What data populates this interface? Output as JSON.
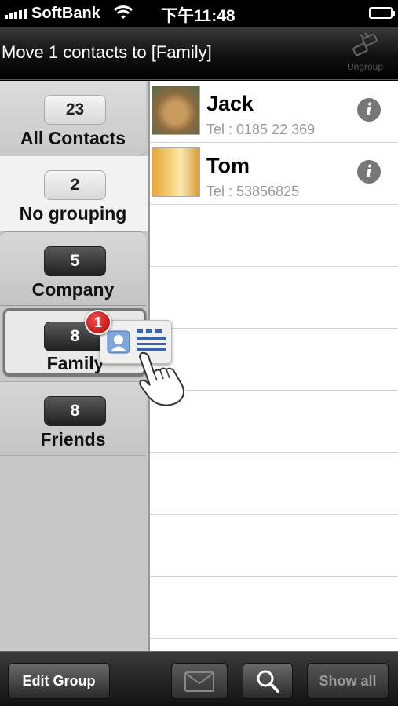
{
  "status_bar": {
    "carrier": "SoftBank",
    "time": "下午11:48"
  },
  "nav": {
    "title": "Move 1 contacts to [Family]",
    "ungroup_label": "Ungroup"
  },
  "groups": [
    {
      "count": "23",
      "name": "All Contacts"
    },
    {
      "count": "2",
      "name": "No grouping"
    },
    {
      "count": "5",
      "name": "Company"
    },
    {
      "count": "8",
      "name": "Family"
    },
    {
      "count": "8",
      "name": "Friends"
    }
  ],
  "contacts": [
    {
      "name": "Jack",
      "tel": "Tel : 0185 22 369"
    },
    {
      "name": "Tom",
      "tel": "Tel : 53856825"
    }
  ],
  "drag": {
    "badge_count": "1"
  },
  "toolbar": {
    "edit_group": "Edit Group",
    "show_all": "Show all"
  },
  "icons": [
    "signal-icon",
    "wifi-icon",
    "battery-icon",
    "ungroup-icon",
    "info-icon",
    "person-icon",
    "list-icon",
    "hand-pointer-icon",
    "mail-icon",
    "search-icon"
  ],
  "colors": {
    "badge": "#d41414",
    "toolbar": "#2a2a2a",
    "sidebar": "#c7c7c7"
  }
}
